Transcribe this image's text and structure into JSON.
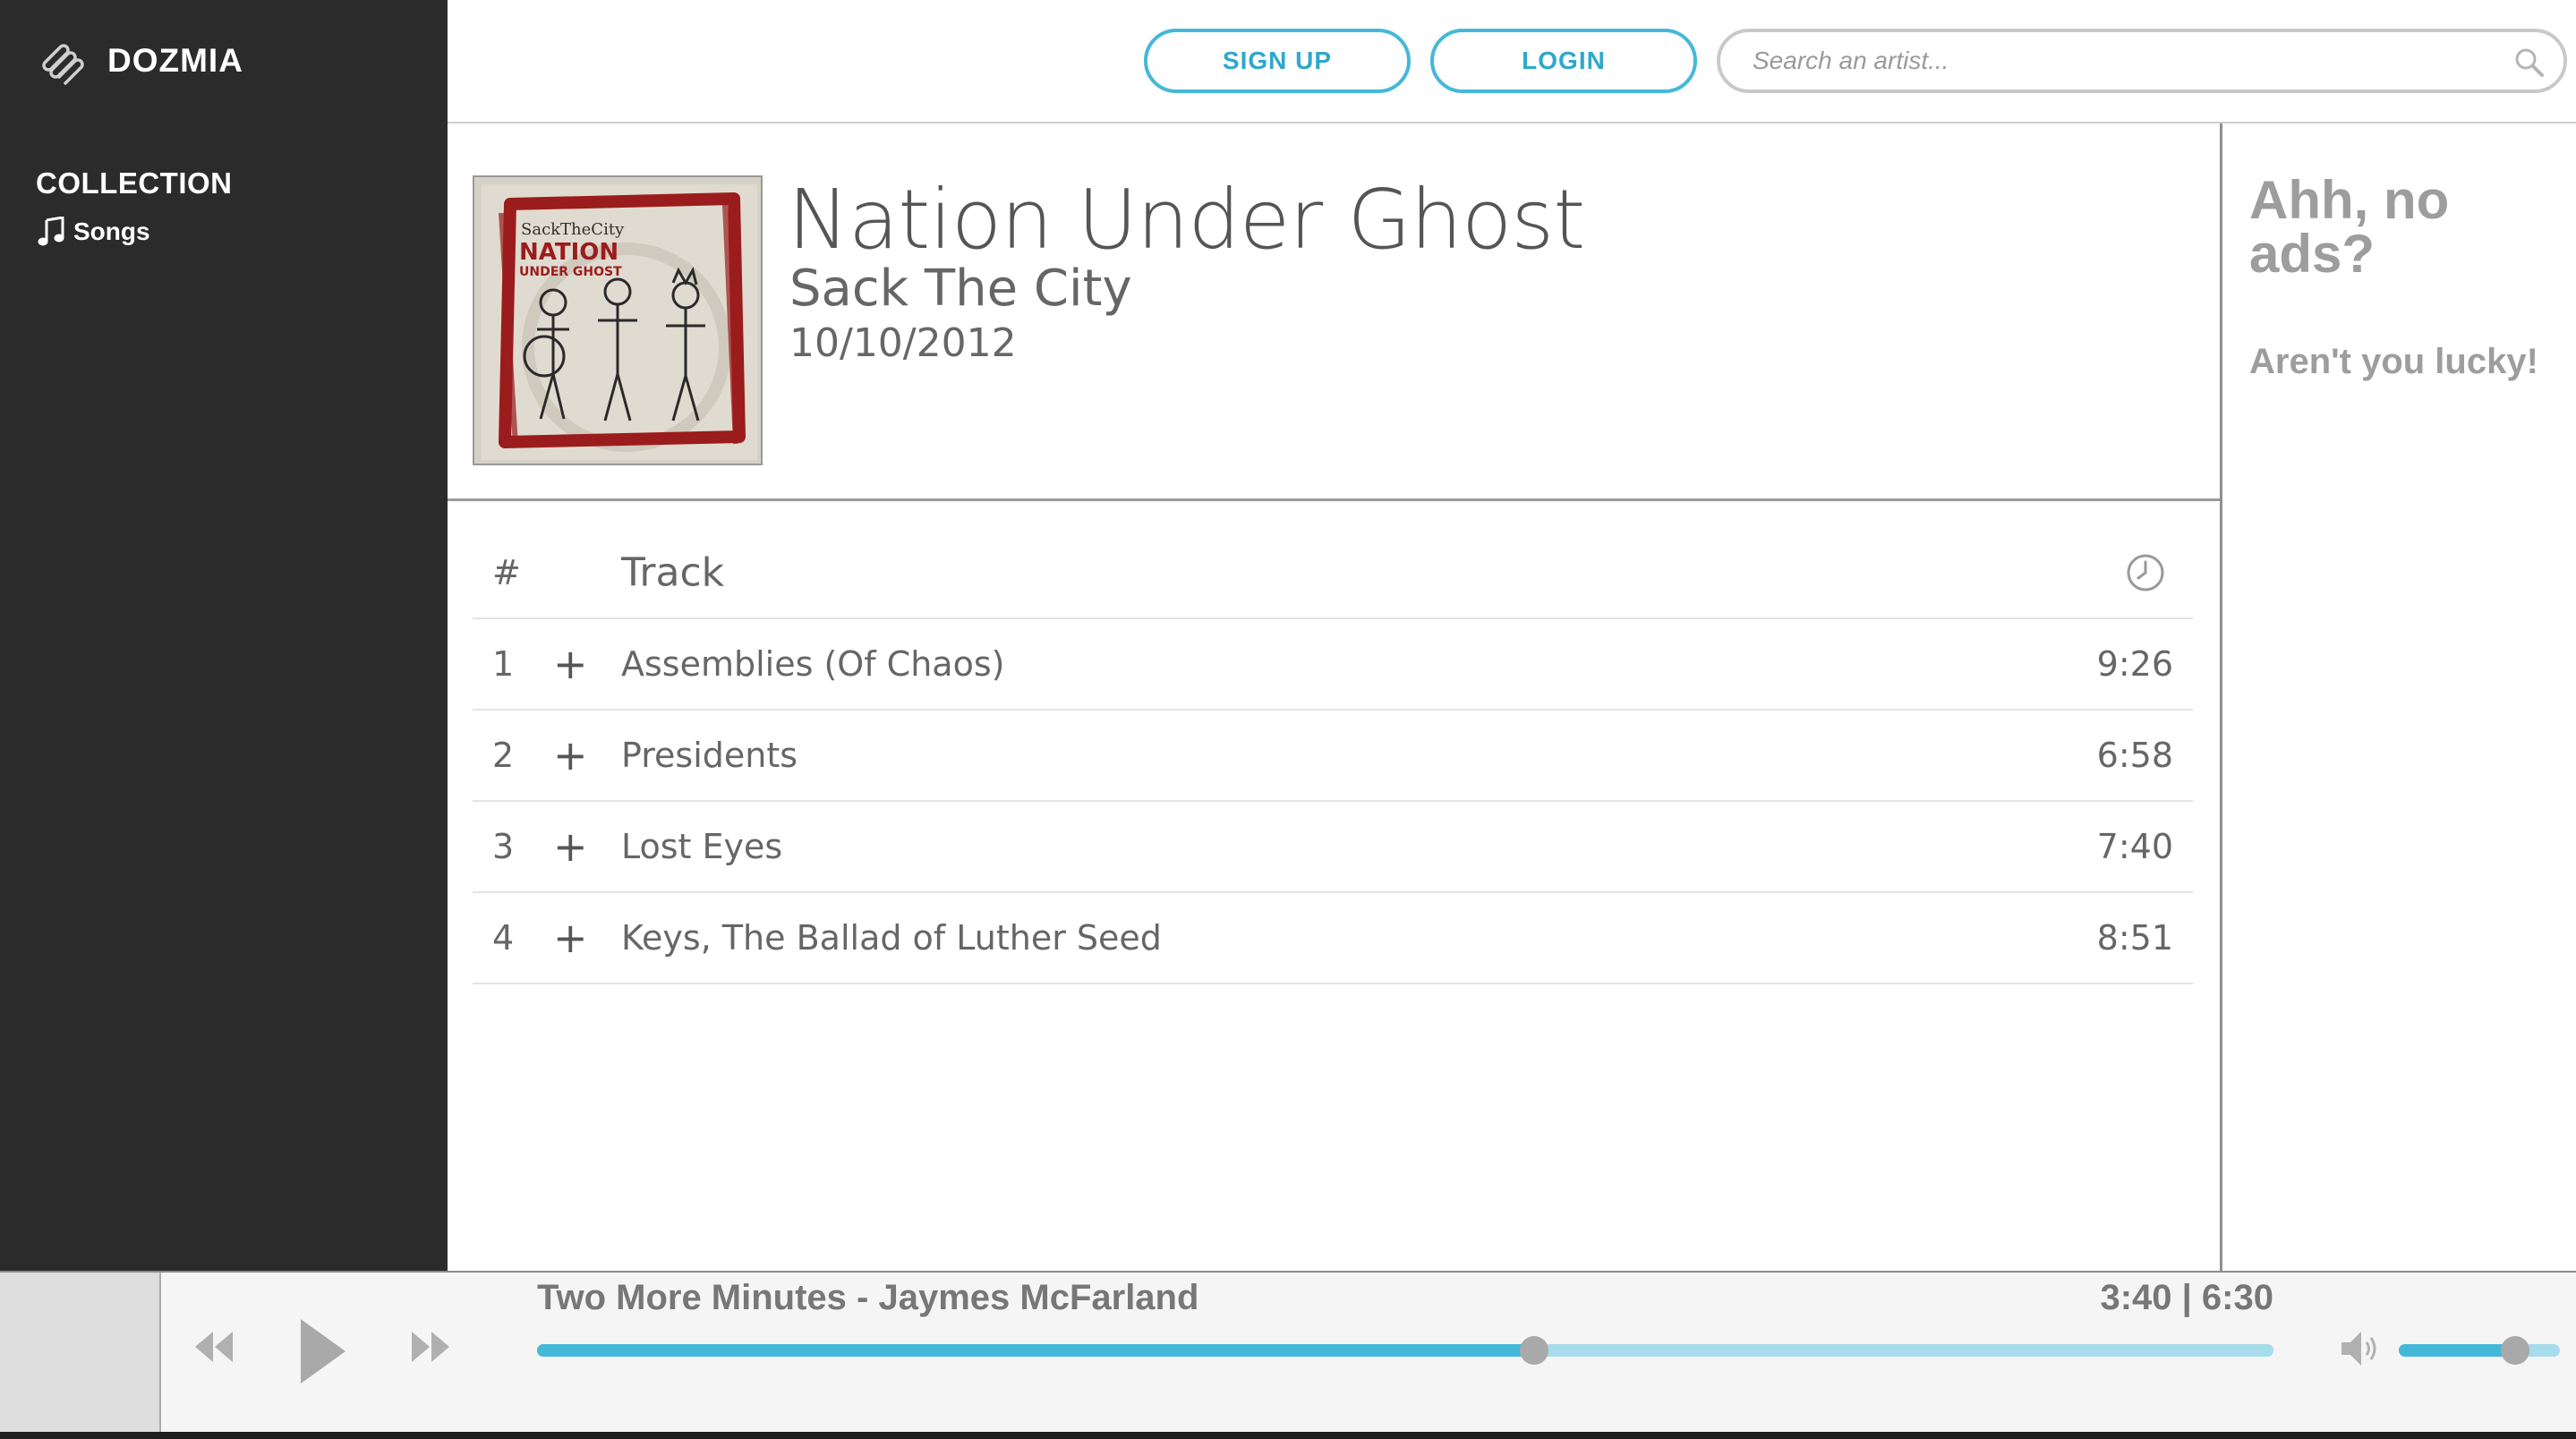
{
  "brand": {
    "name": "DOZMIA",
    "logo_icon": "dozmia-logo-icon"
  },
  "sidebar": {
    "heading": "COLLECTION",
    "items": [
      {
        "label": "Songs",
        "icon": "music-note-icon"
      }
    ]
  },
  "header": {
    "signup_label": "SIGN UP",
    "login_label": "LOGIN",
    "search_placeholder": "Search an artist..."
  },
  "album": {
    "title": "Nation Under Ghost",
    "artist": "Sack The City",
    "date": "10/10/2012",
    "cover_text_top": "SackTheCity",
    "cover_text_main_1": "NATION",
    "cover_text_main_2": "UNDER GHOST"
  },
  "tracklist": {
    "header": {
      "num": "#",
      "track": "Track",
      "duration_icon": "clock-icon"
    },
    "add_symbol": "+",
    "rows": [
      {
        "num": "1",
        "name": "Assemblies (Of Chaos)",
        "time": "9:26"
      },
      {
        "num": "2",
        "name": "Presidents",
        "time": "6:58"
      },
      {
        "num": "3",
        "name": "Lost Eyes",
        "time": "7:40"
      },
      {
        "num": "4",
        "name": "Keys, The Ballad of Luther Seed",
        "time": "8:51"
      }
    ]
  },
  "ad": {
    "title": "Ahh, no ads?",
    "subtitle": "Aren't you lucky!"
  },
  "player": {
    "now_playing": "Two More Minutes - Jaymes McFarland",
    "time": "3:40 | 6:30",
    "progress_fraction": 0.574,
    "volume_fraction": 0.72
  },
  "colors": {
    "accent": "#45b8d8",
    "sidebar_bg": "#2b2b2b",
    "ad_text": "#9d9d9d"
  }
}
